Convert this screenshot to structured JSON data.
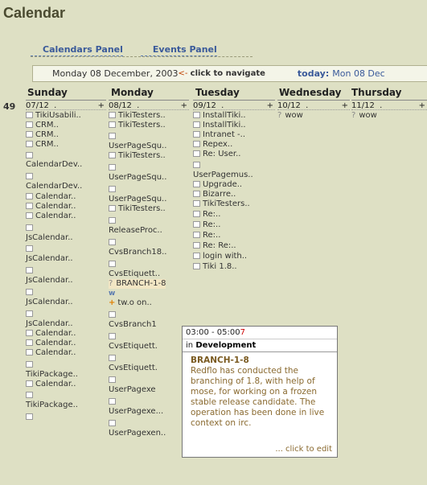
{
  "app": {
    "title": "Calendar"
  },
  "panels": {
    "calendars": "Calendars Panel",
    "events": "Events Panel"
  },
  "nav": {
    "date": "Monday 08 December, 2003",
    "arrow": "<-",
    "hint": "click to navigate",
    "today_label": "today:",
    "today_value": "Mon 08 Dec"
  },
  "days": [
    "Sunday",
    "Monday",
    "Tuesday",
    "Wednesday",
    "Thursday"
  ],
  "week": "49",
  "columns": [
    {
      "date": "07/12",
      "events": [
        "TikiUsabili..",
        "CRM..",
        "CRM..",
        "CRM..",
        "",
        "CalendarDev..",
        "",
        "CalendarDev..",
        "Calendar..",
        "Calendar..",
        "Calendar..",
        "",
        "JsCalendar..",
        "",
        "JsCalendar..",
        "",
        "JsCalendar..",
        "",
        "JsCalendar..",
        "",
        "JsCalendar..",
        "Calendar..",
        "Calendar..",
        "Calendar..",
        "",
        "TikiPackage..",
        "Calendar..",
        "",
        "TikiPackage..",
        ""
      ]
    },
    {
      "date": "08/12",
      "events": [
        "TikiTesters..",
        "TikiTesters..",
        "",
        "UserPageSqu..",
        "TikiTesters..",
        "",
        "UserPageSqu..",
        "",
        "UserPageSqu..",
        "TikiTesters..",
        "",
        "ReleaseProc..",
        "",
        "CvsBranch18..",
        "",
        "CvsEtiquett..",
        "BRANCH-1-8",
        "w",
        "tw.o on..",
        "",
        "CvsBranch1",
        "",
        "CvsEtiquett.",
        "",
        "CvsEtiquett.",
        "",
        "UserPagexe",
        "",
        "UserPagexe...",
        "",
        "UserPagexen.."
      ]
    },
    {
      "date": "09/12",
      "events": [
        "InstallTiki..",
        "InstallTiki..",
        "Intranet -..",
        "Repex..",
        "Re: User..",
        "",
        "UserPagemus..",
        "Upgrade..",
        "Bizarre..",
        "TikiTesters..",
        "Re:..",
        "Re:..",
        "Re:..",
        "Re: Re:..",
        "login with..",
        "Tiki 1.8.."
      ]
    },
    {
      "date": "10/12",
      "events": [
        "wow"
      ]
    },
    {
      "date": "11/12",
      "events": [
        "wow"
      ]
    }
  ],
  "tooltip": {
    "time_start": "03:00 - 05:00",
    "time_end_digit": "7",
    "cat_prefix": "in",
    "category": "Development",
    "title": "BRANCH-1-8",
    "description": "Redflo has conducted the branching of 1.8, with help of mose, for working on a frozen stable release candidate. The operation has been done in live context on irc.",
    "edit": "... click to edit"
  }
}
